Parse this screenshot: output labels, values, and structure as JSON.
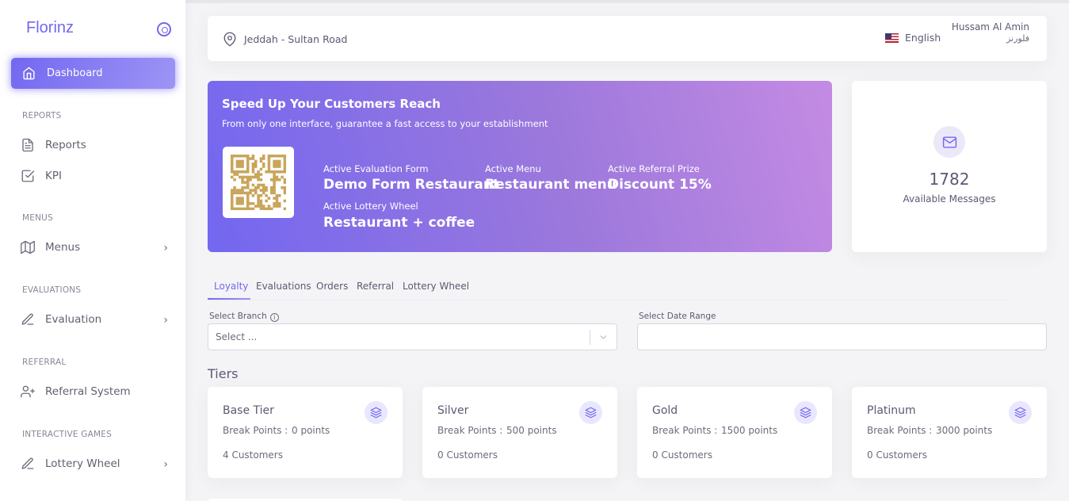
{
  "app": {
    "brand": "Florinz"
  },
  "sidebar": {
    "active": {
      "label": "Dashboard",
      "icon": "home-icon"
    },
    "sections": [
      {
        "title": "REPORTS",
        "items": [
          {
            "label": "Reports",
            "icon": "file-text-icon"
          },
          {
            "label": "KPI",
            "icon": "check-square-icon"
          }
        ]
      },
      {
        "title": "MENUS",
        "items": [
          {
            "label": "Menus",
            "icon": "map-icon"
          }
        ]
      },
      {
        "title": "EVALUATIONS",
        "items": [
          {
            "label": "Evaluation",
            "icon": "pen-icon"
          }
        ]
      },
      {
        "title": "REFERRAL",
        "items": [
          {
            "label": "Referral System",
            "icon": "user-plus-icon"
          }
        ]
      },
      {
        "title": "INTERACTIVE GAMES",
        "items": [
          {
            "label": "Lottery Wheel",
            "icon": "pen-icon"
          }
        ]
      }
    ]
  },
  "header": {
    "location": "Jeddah - Sultan Road",
    "language": "English",
    "user_name": "Hussam Al Amin",
    "user_sub": "فلورنز"
  },
  "promo": {
    "title": "Speed Up Your Customers Reach",
    "subtitle": "From only one interface, guarantee a fast access to your establishment",
    "stats": [
      {
        "label": "Active Evaluation Form",
        "value": "Demo Form Restaurant"
      },
      {
        "label": "Active Menu",
        "value": "Restaurant menu"
      },
      {
        "label": "Active Referral Prize",
        "value": "Discount 15%"
      },
      {
        "label": "Active Lottery Wheel",
        "value": "Restaurant + coffee"
      }
    ]
  },
  "messages": {
    "count": "1782",
    "label": "Available Messages"
  },
  "tabs": [
    "Loyalty",
    "Evaluations",
    "Orders",
    "Referral",
    "Lottery Wheel"
  ],
  "filters": {
    "branch_label": "Select Branch",
    "branch_placeholder": "Select ...",
    "date_label": "Select Date Range"
  },
  "tiers": {
    "title": "Tiers",
    "bp_label": "Break Points :",
    "items": [
      {
        "name": "Base Tier",
        "points": "0 points",
        "customers": "4 Customers"
      },
      {
        "name": "Silver",
        "points": "500 points",
        "customers": "0 Customers"
      },
      {
        "name": "Gold",
        "points": "1500 points",
        "customers": "0 Customers"
      },
      {
        "name": "Platinum",
        "points": "3000 points",
        "customers": "0 Customers"
      }
    ]
  },
  "colors": {
    "accent": "#7367f0",
    "text": "#5e5873"
  }
}
